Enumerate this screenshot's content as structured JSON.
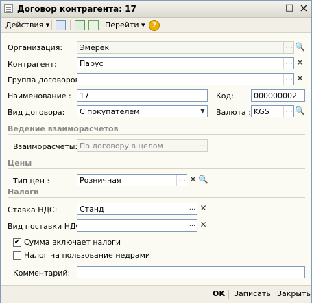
{
  "window": {
    "title": "Договор контрагента: 17",
    "min": "_",
    "max": "□",
    "close": "×"
  },
  "toolbar": {
    "actions": "Действия",
    "go": "Перейти",
    "help": "?",
    "arrow": "▾"
  },
  "fields": {
    "organization": {
      "label": "Организация:",
      "value": "Эмерек"
    },
    "counterparty": {
      "label": "Контрагент:",
      "value": "Парус"
    },
    "contract_group": {
      "label": "Группа договоров:",
      "value": ""
    },
    "name": {
      "label": "Наименование :",
      "value": "17"
    },
    "code": {
      "label": "Код:",
      "value": "000000002"
    },
    "contract_type": {
      "label": "Вид договора:",
      "value": "С покупателем"
    },
    "currency": {
      "label": "Валюта :",
      "value": "KGS"
    },
    "settlements": {
      "label": "Взаиморасчеты:",
      "value": "По договору в целом"
    },
    "price_type": {
      "label": "Тип цен :",
      "value": "Розничная"
    },
    "vat_rate": {
      "label": "Ставка НДС:",
      "value": "Станд"
    },
    "vat_supply": {
      "label": "Вид поставки НДС:",
      "value": ""
    },
    "comment": {
      "label": "Комментарий:",
      "value": ""
    }
  },
  "sections": {
    "settlements": "Ведение взаиморасчетов",
    "prices": "Цены",
    "taxes": "Налоги"
  },
  "checks": {
    "include_taxes": {
      "label": "Сумма включает налоги",
      "checked": true,
      "mark": "✔"
    },
    "mining_tax": {
      "label": "Налог на пользование недрами",
      "checked": false,
      "mark": ""
    }
  },
  "buttons": {
    "ellipsis": "...",
    "clear": "✕",
    "search": "🔍",
    "ok": "OK",
    "save": "Записать",
    "close": "Закрыть"
  }
}
